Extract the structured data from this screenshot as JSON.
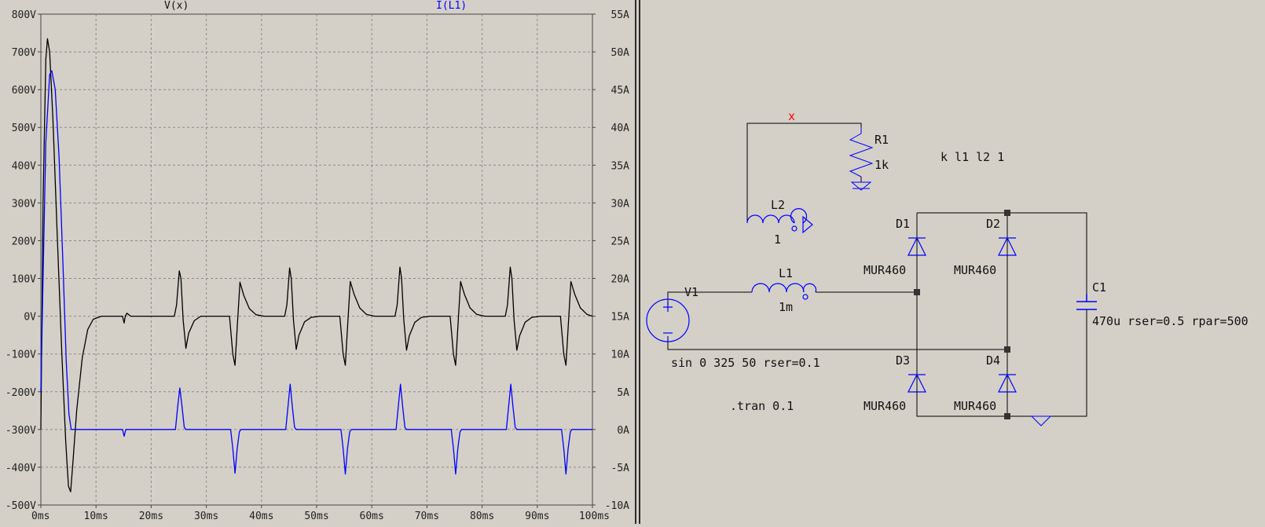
{
  "colors": {
    "voltage_trace": "#000000",
    "current_trace": "#0000ff",
    "component": "#0000ff",
    "wire": "#000000",
    "net_label": "#ff0000",
    "background": "#d4d0c8"
  },
  "waveform": {
    "left_trace_label": "V(x)",
    "right_trace_label": "I(L1)",
    "x_ticks": [
      "0ms",
      "10ms",
      "20ms",
      "30ms",
      "40ms",
      "50ms",
      "60ms",
      "70ms",
      "80ms",
      "90ms",
      "100ms"
    ],
    "y_left_ticks": [
      "800V",
      "700V",
      "600V",
      "500V",
      "400V",
      "300V",
      "200V",
      "100V",
      "0V",
      "-100V",
      "-200V",
      "-300V",
      "-400V",
      "-500V"
    ],
    "y_right_ticks": [
      "55A",
      "50A",
      "45A",
      "40A",
      "35A",
      "30A",
      "25A",
      "20A",
      "15A",
      "10A",
      "5A",
      "0A",
      "-5A",
      "-10A"
    ],
    "grid": "dashed"
  },
  "chart_data": {
    "type": "line",
    "xlabel": "",
    "x_unit": "ms",
    "xlim": [
      0,
      100
    ],
    "ylim_left": [
      -500,
      800
    ],
    "ylim_right": [
      -10,
      55
    ],
    "series": [
      {
        "name": "V(x)",
        "axis": "left",
        "color": "#000000",
        "points": [
          [
            0,
            -300
          ],
          [
            0.4,
            300
          ],
          [
            0.9,
            680
          ],
          [
            1.2,
            735
          ],
          [
            1.6,
            700
          ],
          [
            2.2,
            520
          ],
          [
            3,
            200
          ],
          [
            3.8,
            -100
          ],
          [
            4.5,
            -330
          ],
          [
            5,
            -450
          ],
          [
            5.4,
            -465
          ],
          [
            5.8,
            -390
          ],
          [
            6.5,
            -250
          ],
          [
            7.5,
            -110
          ],
          [
            8.5,
            -35
          ],
          [
            9.5,
            -8
          ],
          [
            11,
            0
          ],
          [
            14.8,
            0
          ],
          [
            15.1,
            -18
          ],
          [
            15.3,
            0
          ],
          [
            15.6,
            8
          ],
          [
            16.3,
            0
          ],
          [
            24.2,
            0
          ],
          [
            24.6,
            30
          ],
          [
            25.1,
            120
          ],
          [
            25.4,
            100
          ],
          [
            25.8,
            -10
          ],
          [
            26.3,
            -85
          ],
          [
            26.8,
            -45
          ],
          [
            27.8,
            -12
          ],
          [
            29,
            0
          ],
          [
            34.2,
            0
          ],
          [
            34.8,
            -100
          ],
          [
            35.2,
            -130
          ],
          [
            35.6,
            -30
          ],
          [
            36.1,
            90
          ],
          [
            36.8,
            55
          ],
          [
            37.8,
            20
          ],
          [
            39,
            4
          ],
          [
            40.5,
            0
          ],
          [
            44.2,
            0
          ],
          [
            44.6,
            30
          ],
          [
            45.1,
            128
          ],
          [
            45.4,
            100
          ],
          [
            45.8,
            -10
          ],
          [
            46.3,
            -88
          ],
          [
            46.8,
            -50
          ],
          [
            47.8,
            -15
          ],
          [
            49,
            -3
          ],
          [
            50.5,
            0
          ],
          [
            54.2,
            0
          ],
          [
            54.8,
            -100
          ],
          [
            55.2,
            -130
          ],
          [
            55.6,
            -30
          ],
          [
            56.1,
            92
          ],
          [
            56.8,
            58
          ],
          [
            57.8,
            22
          ],
          [
            59,
            5
          ],
          [
            60.5,
            0
          ],
          [
            64.2,
            0
          ],
          [
            64.6,
            30
          ],
          [
            65.1,
            130
          ],
          [
            65.4,
            100
          ],
          [
            65.8,
            -10
          ],
          [
            66.3,
            -90
          ],
          [
            66.8,
            -52
          ],
          [
            67.8,
            -16
          ],
          [
            69,
            -3
          ],
          [
            70.5,
            0
          ],
          [
            74.2,
            0
          ],
          [
            74.8,
            -100
          ],
          [
            75.2,
            -130
          ],
          [
            75.6,
            -30
          ],
          [
            76.1,
            92
          ],
          [
            76.8,
            58
          ],
          [
            77.8,
            22
          ],
          [
            79,
            5
          ],
          [
            80.5,
            0
          ],
          [
            84.2,
            0
          ],
          [
            84.6,
            30
          ],
          [
            85.1,
            130
          ],
          [
            85.4,
            100
          ],
          [
            85.8,
            -10
          ],
          [
            86.3,
            -90
          ],
          [
            86.8,
            -52
          ],
          [
            87.8,
            -16
          ],
          [
            89,
            -3
          ],
          [
            90.5,
            0
          ],
          [
            94.2,
            0
          ],
          [
            94.8,
            -100
          ],
          [
            95.2,
            -130
          ],
          [
            95.6,
            -30
          ],
          [
            96.1,
            92
          ],
          [
            96.8,
            58
          ],
          [
            97.8,
            22
          ],
          [
            99,
            5
          ],
          [
            100,
            0
          ]
        ]
      },
      {
        "name": "I(L1)",
        "axis": "right",
        "color": "#0000ff",
        "points": [
          [
            0,
            5
          ],
          [
            0.4,
            20
          ],
          [
            0.9,
            38
          ],
          [
            1.6,
            47
          ],
          [
            2,
            47.5
          ],
          [
            2.6,
            45
          ],
          [
            3.3,
            36
          ],
          [
            4,
            22
          ],
          [
            4.6,
            9
          ],
          [
            5.1,
            2
          ],
          [
            5.5,
            0
          ],
          [
            14.8,
            0
          ],
          [
            15.1,
            -0.9
          ],
          [
            15.4,
            0
          ],
          [
            24.4,
            0
          ],
          [
            24.8,
            3
          ],
          [
            25.2,
            5.5
          ],
          [
            25.6,
            3
          ],
          [
            26,
            0.3
          ],
          [
            26.3,
            0
          ],
          [
            34.4,
            0
          ],
          [
            34.8,
            -2.5
          ],
          [
            35.2,
            -5.8
          ],
          [
            35.6,
            -2.5
          ],
          [
            36,
            -0.3
          ],
          [
            36.3,
            0
          ],
          [
            44.4,
            0
          ],
          [
            44.8,
            3
          ],
          [
            45.2,
            6
          ],
          [
            45.6,
            3
          ],
          [
            46,
            0.3
          ],
          [
            46.3,
            0
          ],
          [
            54.4,
            0
          ],
          [
            54.8,
            -2.5
          ],
          [
            55.2,
            -5.9
          ],
          [
            55.6,
            -2.5
          ],
          [
            56,
            -0.3
          ],
          [
            56.3,
            0
          ],
          [
            64.4,
            0
          ],
          [
            64.8,
            3
          ],
          [
            65.2,
            6
          ],
          [
            65.6,
            3
          ],
          [
            66,
            0.3
          ],
          [
            66.3,
            0
          ],
          [
            74.4,
            0
          ],
          [
            74.8,
            -2.5
          ],
          [
            75.2,
            -5.9
          ],
          [
            75.6,
            -2.5
          ],
          [
            76,
            -0.3
          ],
          [
            76.3,
            0
          ],
          [
            84.4,
            0
          ],
          [
            84.8,
            3
          ],
          [
            85.2,
            6
          ],
          [
            85.6,
            3
          ],
          [
            86,
            0.3
          ],
          [
            86.3,
            0
          ],
          [
            94.4,
            0
          ],
          [
            94.8,
            -2.5
          ],
          [
            95.2,
            -5.9
          ],
          [
            95.6,
            -2.5
          ],
          [
            96,
            -0.3
          ],
          [
            96.3,
            0
          ],
          [
            100,
            0
          ]
        ]
      }
    ]
  },
  "schematic": {
    "net_label_x": "x",
    "r1_name": "R1",
    "r1_value": "1k",
    "coupling": "k l1 l2 1",
    "l2_name": "L2",
    "l2_value": "1",
    "l1_name": "L1",
    "l1_value": "1m",
    "v1_name": "V1",
    "v1_value": "sin 0 325 50 rser=0.1",
    "d1_name": "D1",
    "d1_model": "MUR460",
    "d2_name": "D2",
    "d2_model": "MUR460",
    "d3_name": "D3",
    "d3_model": "MUR460",
    "d4_name": "D4",
    "d4_model": "MUR460",
    "c1_name": "C1",
    "c1_value": "470u rser=0.5 rpar=500",
    "directive": ".tran 0.1"
  }
}
